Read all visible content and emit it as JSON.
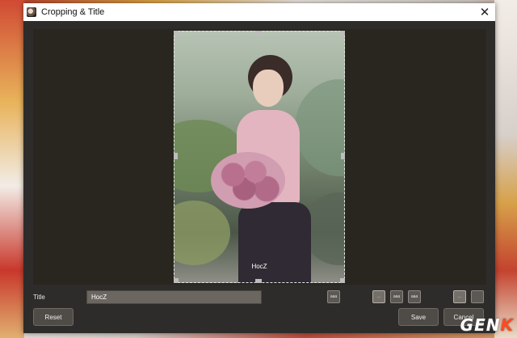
{
  "window": {
    "title": "Cropping & Title",
    "close_glyph": "✕"
  },
  "photo": {
    "caption": "HocZ"
  },
  "form": {
    "title_label": "Title",
    "title_value": "HocZ"
  },
  "small_buttons": [
    {
      "name": "position-preset-a",
      "label": "aaa"
    },
    {
      "name": "position-preset-b",
      "label": "..."
    },
    {
      "name": "position-preset-c",
      "label": "aaa"
    },
    {
      "name": "position-preset-d",
      "label": "aaa"
    },
    {
      "name": "layout-preset-a",
      "label": "..."
    },
    {
      "name": "layout-preset-b",
      "label": ""
    }
  ],
  "buttons": {
    "reset": "Reset",
    "save": "Save",
    "cancel": "Cancel"
  },
  "watermark": {
    "part1": "GEN",
    "part2": "K"
  }
}
